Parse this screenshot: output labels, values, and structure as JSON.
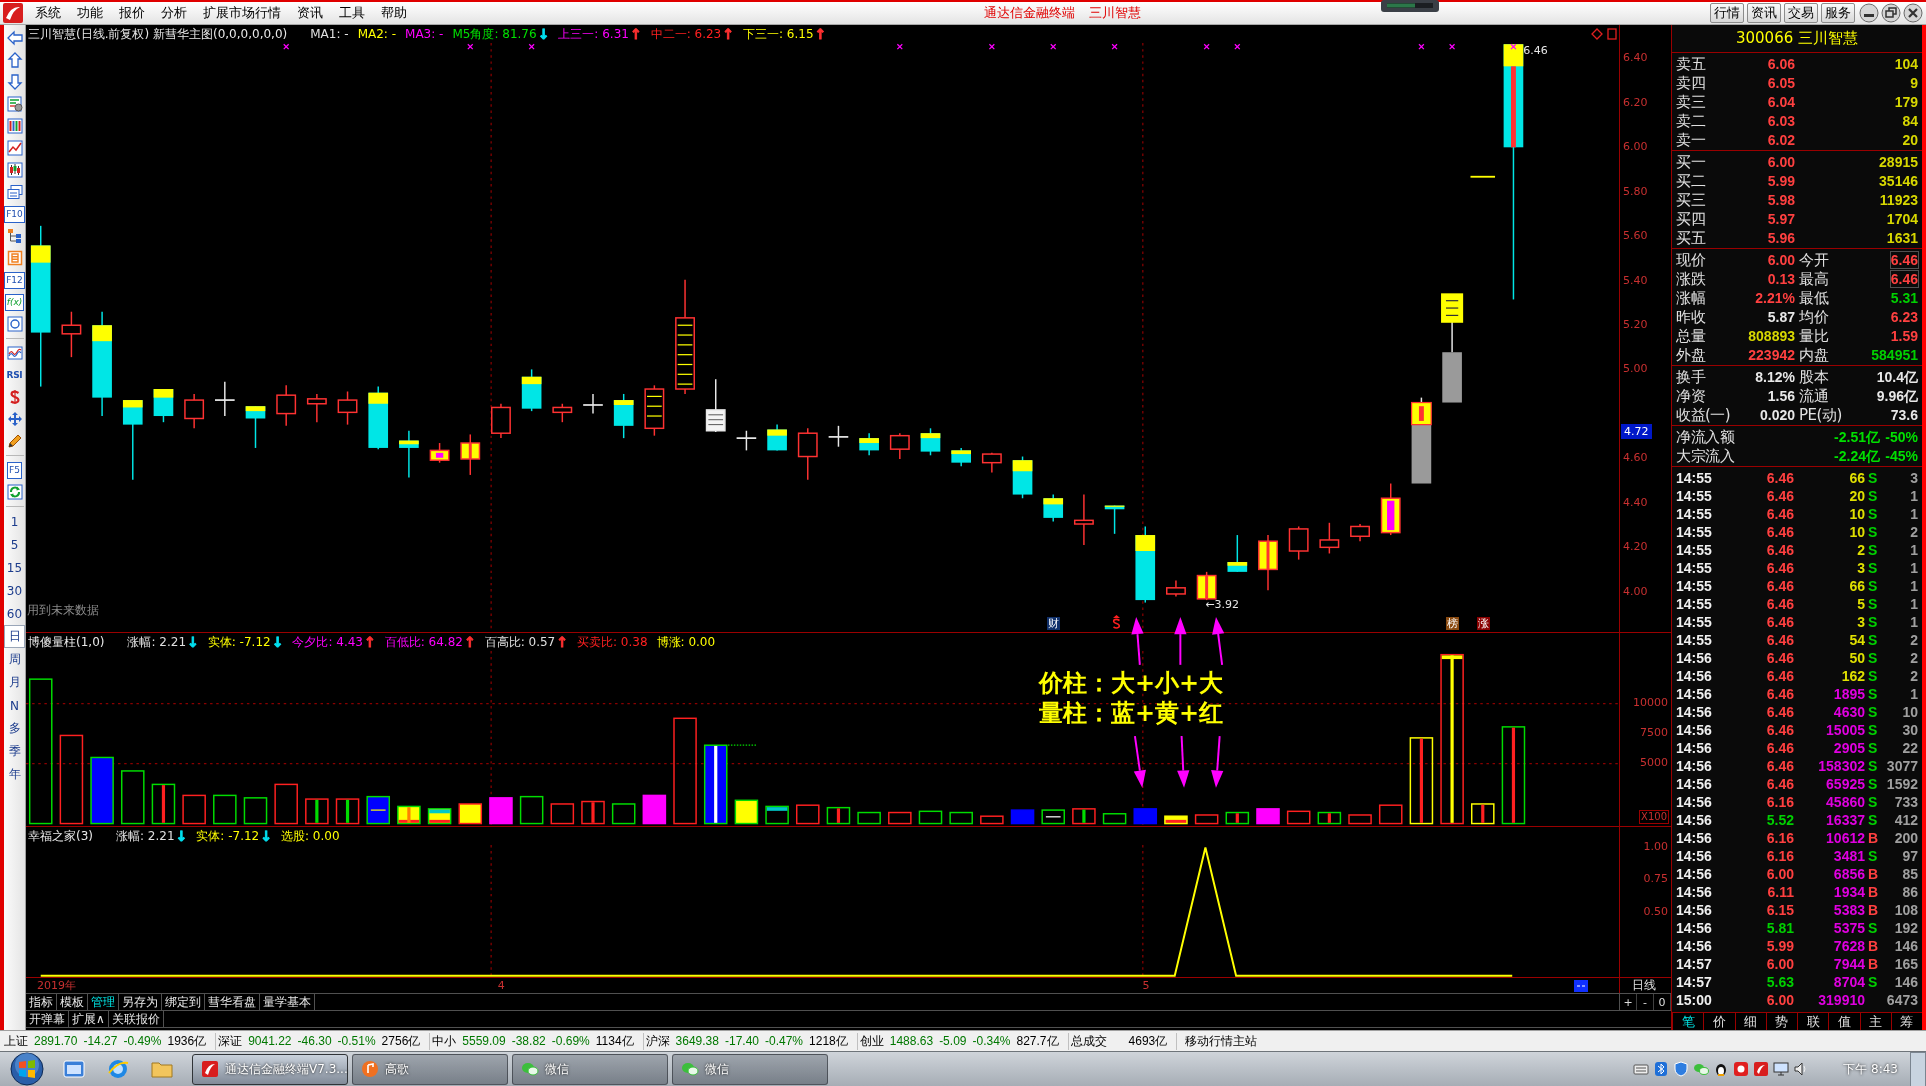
{
  "window": {
    "menu": [
      "系统",
      "功能",
      "报价",
      "分析",
      "扩展市场行情",
      "资讯",
      "工具",
      "帮助"
    ],
    "title": "通达信金融终端",
    "subtitle": "三川智慧",
    "buttons": [
      "行情",
      "资讯",
      "交易",
      "服务"
    ]
  },
  "toolbar": {
    "buttons": [
      {
        "label": "F10",
        "kind": "key"
      },
      {
        "label": "F12",
        "kind": "key"
      },
      {
        "label": "f(x)",
        "kind": "formula"
      },
      {
        "label": "RSI",
        "kind": "indicator"
      },
      {
        "label": "F5",
        "kind": "key"
      }
    ],
    "periods": [
      {
        "label": "1",
        "selected": false
      },
      {
        "label": "5",
        "selected": false
      },
      {
        "label": "15",
        "selected": false
      },
      {
        "label": "30",
        "selected": false
      },
      {
        "label": "60",
        "selected": false
      },
      {
        "label": "日",
        "selected": true
      },
      {
        "label": "周",
        "selected": false
      },
      {
        "label": "月",
        "selected": false
      },
      {
        "label": "N",
        "selected": false
      },
      {
        "label": "多",
        "selected": false
      },
      {
        "label": "季",
        "selected": false
      },
      {
        "label": "年",
        "selected": false
      }
    ]
  },
  "price_chart": {
    "title": "三川智慧(日线.前复权) 新彗华主图(0,0,0,0,0,0)",
    "readings": [
      {
        "text": "MA1: -",
        "color": "#e0e0e0"
      },
      {
        "text": "MA2: -",
        "color": "#ffff00"
      },
      {
        "text": "MA3: -",
        "color": "#ff00ff"
      },
      {
        "text": "M5角度: 81.76",
        "color": "#00e000",
        "arrow": {
          "text": "↓",
          "color": "#00e0f0"
        }
      },
      {
        "text": "上三一: 6.31",
        "color": "#ff00ff",
        "arrow": {
          "text": "↑",
          "color": "#ff3030"
        }
      },
      {
        "text": "中二一: 6.23",
        "color": "#ff2020",
        "arrow": {
          "text": "↑",
          "color": "#ff3030"
        }
      },
      {
        "text": "下三一: 6.15",
        "color": "#ffff00",
        "arrow": {
          "text": "↑",
          "color": "#ff3030"
        }
      }
    ],
    "axis": [
      "6.40",
      "6.20",
      "6.00",
      "5.80",
      "5.60",
      "5.40",
      "5.20",
      "5.00",
      "4.60",
      "4.40",
      "4.20",
      "4.00"
    ],
    "cursor_price": "4.72",
    "high_label": "6.46",
    "low_label": "←3.92",
    "note": "用到未来数据",
    "markers": [
      {
        "label": "财",
        "color": "#10306a"
      },
      {
        "label": "榜",
        "color": "#8a4a10"
      },
      {
        "label": "涨",
        "color": "#8a0000"
      }
    ],
    "annotations": [
      "价柱：大+小+大",
      "量柱：蓝+黄+红"
    ]
  },
  "volume_chart": {
    "title": "博傻量柱(1,0)",
    "readings": [
      {
        "text": "涨幅: 2.21",
        "color": "#e0e0e0",
        "arrow": {
          "text": "↓",
          "color": "#00e0f0"
        }
      },
      {
        "text": "实体: -7.12",
        "color": "#ffff00",
        "arrow": {
          "text": "↓",
          "color": "#00e0f0"
        }
      },
      {
        "text": "今夕比: 4.43",
        "color": "#ff00ff",
        "arrow": {
          "text": "↑",
          "color": "#ff3030"
        }
      },
      {
        "text": "百低比: 64.82",
        "color": "#ff00ff",
        "arrow": {
          "text": "↑",
          "color": "#ff3030"
        }
      },
      {
        "text": "百高比: 0.57",
        "color": "#e0e0e0",
        "arrow": {
          "text": "↑",
          "color": "#ff3030"
        }
      },
      {
        "text": "买卖比: 0.38",
        "color": "#ff2020"
      },
      {
        "text": "博涨: 0.00",
        "color": "#ffff00"
      }
    ],
    "axis": [
      "10000",
      "7500",
      "5000"
    ],
    "unit": "X100"
  },
  "indicator_chart": {
    "title": "幸福之家(3)",
    "readings": [
      {
        "text": "涨幅: 2.21",
        "color": "#e0e0e0",
        "arrow": {
          "text": "↓",
          "color": "#00e0f0"
        }
      },
      {
        "text": "实体: -7.12",
        "color": "#ffff00",
        "arrow": {
          "text": "↓",
          "color": "#00e0f0"
        }
      },
      {
        "text": "选股: 0.00",
        "color": "#ffff00"
      }
    ],
    "axis": [
      "1.00",
      "0.75",
      "0.50"
    ]
  },
  "date_axis": [
    "2019年",
    "4",
    "5"
  ],
  "period_label": "日线",
  "zoom_buttons": [
    "+",
    "-",
    "0"
  ],
  "bottom_tabs": [
    {
      "label": "指标",
      "selected": false
    },
    {
      "label": "模板",
      "selected": false
    },
    {
      "label": "管理",
      "selected": true
    },
    {
      "label": "另存为",
      "selected": false
    },
    {
      "label": "绑定到",
      "selected": false
    },
    {
      "label": "彗华看盘",
      "selected": false
    },
    {
      "label": "量学基本",
      "selected": false
    }
  ],
  "bottom_links": [
    "开弹幕",
    "扩展∧",
    "关联报价"
  ],
  "quote": {
    "title": "300066 三川智慧",
    "asks": [
      {
        "label": "卖五",
        "price": "6.06",
        "volume": "104"
      },
      {
        "label": "卖四",
        "price": "6.05",
        "volume": "9"
      },
      {
        "label": "卖三",
        "price": "6.04",
        "volume": "179"
      },
      {
        "label": "卖二",
        "price": "6.03",
        "volume": "84"
      },
      {
        "label": "卖一",
        "price": "6.02",
        "volume": "20"
      }
    ],
    "bids": [
      {
        "label": "买一",
        "price": "6.00",
        "volume": "28915"
      },
      {
        "label": "买二",
        "price": "5.99",
        "volume": "35146"
      },
      {
        "label": "买三",
        "price": "5.98",
        "volume": "11923"
      },
      {
        "label": "买四",
        "price": "5.97",
        "volume": "1704"
      },
      {
        "label": "买五",
        "price": "5.96",
        "volume": "1631"
      }
    ],
    "stats": [
      [
        {
          "label": "现价",
          "value": "6.00",
          "color": "#ff4040",
          "framed": false
        },
        {
          "label": "今开",
          "value": "6.46",
          "color": "#ff4040",
          "framed": true
        }
      ],
      [
        {
          "label": "涨跌",
          "value": "0.13",
          "color": "#ff4040",
          "framed": false
        },
        {
          "label": "最高",
          "value": "6.46",
          "color": "#ff4040",
          "framed": true
        }
      ],
      [
        {
          "label": "涨幅",
          "value": "2.21%",
          "color": "#ff4040",
          "framed": false
        },
        {
          "label": "最低",
          "value": "5.31",
          "color": "#00d000",
          "framed": false
        }
      ],
      [
        {
          "label": "昨收",
          "value": "5.87",
          "color": "#e8e8e8",
          "framed": false
        },
        {
          "label": "均价",
          "value": "6.23",
          "color": "#ff4040",
          "framed": false
        }
      ],
      [
        {
          "label": "总量",
          "value": "808893",
          "color": "#d8d800",
          "framed": false
        },
        {
          "label": "量比",
          "value": "1.59",
          "color": "#ff4040",
          "framed": false
        }
      ],
      [
        {
          "label": "外盘",
          "value": "223942",
          "color": "#ff4040",
          "framed": false
        },
        {
          "label": "内盘",
          "value": "584951",
          "color": "#00d000",
          "framed": false
        }
      ]
    ],
    "fundamentals": [
      [
        {
          "label": "换手",
          "value": "8.12%"
        },
        {
          "label": "股本",
          "value": "10.4亿"
        }
      ],
      [
        {
          "label": "净资",
          "value": "1.56"
        },
        {
          "label": "流通",
          "value": "9.96亿"
        }
      ],
      [
        {
          "label": "收益(一)",
          "value": "0.020"
        },
        {
          "label": "PE(动)",
          "value": "73.6"
        }
      ]
    ],
    "flows": [
      {
        "label": "净流入额",
        "amount": "-2.51亿",
        "pct": "-50%"
      },
      {
        "label": "大宗流入",
        "amount": "-2.24亿",
        "pct": "-45%"
      }
    ],
    "ticks": [
      {
        "time": "14:55",
        "price": {
          "text": "6.46",
          "color": "#ff4040"
        },
        "volume": {
          "text": "66",
          "color": "#e0e000"
        },
        "side": {
          "text": "S",
          "color": "#00d000"
        },
        "count": "3"
      },
      {
        "time": "14:55",
        "price": {
          "text": "6.46",
          "color": "#ff4040"
        },
        "volume": {
          "text": "20",
          "color": "#e0e000"
        },
        "side": {
          "text": "S",
          "color": "#00d000"
        },
        "count": "1"
      },
      {
        "time": "14:55",
        "price": {
          "text": "6.46",
          "color": "#ff4040"
        },
        "volume": {
          "text": "10",
          "color": "#e0e000"
        },
        "side": {
          "text": "S",
          "color": "#00d000"
        },
        "count": "1"
      },
      {
        "time": "14:55",
        "price": {
          "text": "6.46",
          "color": "#ff4040"
        },
        "volume": {
          "text": "10",
          "color": "#e0e000"
        },
        "side": {
          "text": "S",
          "color": "#00d000"
        },
        "count": "2"
      },
      {
        "time": "14:55",
        "price": {
          "text": "6.46",
          "color": "#ff4040"
        },
        "volume": {
          "text": "2",
          "color": "#e0e000"
        },
        "side": {
          "text": "S",
          "color": "#00d000"
        },
        "count": "1"
      },
      {
        "time": "14:55",
        "price": {
          "text": "6.46",
          "color": "#ff4040"
        },
        "volume": {
          "text": "3",
          "color": "#e0e000"
        },
        "side": {
          "text": "S",
          "color": "#00d000"
        },
        "count": "1"
      },
      {
        "time": "14:55",
        "price": {
          "text": "6.46",
          "color": "#ff4040"
        },
        "volume": {
          "text": "66",
          "color": "#e0e000"
        },
        "side": {
          "text": "S",
          "color": "#00d000"
        },
        "count": "1"
      },
      {
        "time": "14:55",
        "price": {
          "text": "6.46",
          "color": "#ff4040"
        },
        "volume": {
          "text": "5",
          "color": "#e0e000"
        },
        "side": {
          "text": "S",
          "color": "#00d000"
        },
        "count": "1"
      },
      {
        "time": "14:55",
        "price": {
          "text": "6.46",
          "color": "#ff4040"
        },
        "volume": {
          "text": "3",
          "color": "#e0e000"
        },
        "side": {
          "text": "S",
          "color": "#00d000"
        },
        "count": "1"
      },
      {
        "time": "14:55",
        "price": {
          "text": "6.46",
          "color": "#ff4040"
        },
        "volume": {
          "text": "54",
          "color": "#e0e000"
        },
        "side": {
          "text": "S",
          "color": "#00d000"
        },
        "count": "2"
      },
      {
        "time": "14:56",
        "price": {
          "text": "6.46",
          "color": "#ff4040"
        },
        "volume": {
          "text": "50",
          "color": "#e0e000"
        },
        "side": {
          "text": "S",
          "color": "#00d000"
        },
        "count": "2"
      },
      {
        "time": "14:56",
        "price": {
          "text": "6.46",
          "color": "#ff4040"
        },
        "volume": {
          "text": "162",
          "color": "#e0e000"
        },
        "side": {
          "text": "S",
          "color": "#00d000"
        },
        "count": "2"
      },
      {
        "time": "14:56",
        "price": {
          "text": "6.46",
          "color": "#ff4040"
        },
        "volume": {
          "text": "1895",
          "color": "#e000e0"
        },
        "side": {
          "text": "S",
          "color": "#00d000"
        },
        "count": "1"
      },
      {
        "time": "14:56",
        "price": {
          "text": "6.46",
          "color": "#ff4040"
        },
        "volume": {
          "text": "4630",
          "color": "#e000e0"
        },
        "side": {
          "text": "S",
          "color": "#00d000"
        },
        "count": "10"
      },
      {
        "time": "14:56",
        "price": {
          "text": "6.46",
          "color": "#ff4040"
        },
        "volume": {
          "text": "15005",
          "color": "#e000e0"
        },
        "side": {
          "text": "S",
          "color": "#00d000"
        },
        "count": "30"
      },
      {
        "time": "14:56",
        "price": {
          "text": "6.46",
          "color": "#ff4040"
        },
        "volume": {
          "text": "2905",
          "color": "#e000e0"
        },
        "side": {
          "text": "S",
          "color": "#00d000"
        },
        "count": "22"
      },
      {
        "time": "14:56",
        "price": {
          "text": "6.46",
          "color": "#ff4040"
        },
        "volume": {
          "text": "158302",
          "color": "#e000e0"
        },
        "side": {
          "text": "S",
          "color": "#00d000"
        },
        "count": "3077"
      },
      {
        "time": "14:56",
        "price": {
          "text": "6.46",
          "color": "#ff4040"
        },
        "volume": {
          "text": "65925",
          "color": "#e000e0"
        },
        "side": {
          "text": "S",
          "color": "#00d000"
        },
        "count": "1592"
      },
      {
        "time": "14:56",
        "price": {
          "text": "6.16",
          "color": "#ff4040"
        },
        "volume": {
          "text": "45860",
          "color": "#e000e0"
        },
        "side": {
          "text": "S",
          "color": "#00d000"
        },
        "count": "733"
      },
      {
        "time": "14:56",
        "price": {
          "text": "5.52",
          "color": "#00d000"
        },
        "volume": {
          "text": "16337",
          "color": "#e000e0"
        },
        "side": {
          "text": "S",
          "color": "#00d000"
        },
        "count": "412"
      },
      {
        "time": "14:56",
        "price": {
          "text": "6.16",
          "color": "#ff4040"
        },
        "volume": {
          "text": "10612",
          "color": "#e000e0"
        },
        "side": {
          "text": "B",
          "color": "#ff4040"
        },
        "count": "200"
      },
      {
        "time": "14:56",
        "price": {
          "text": "6.16",
          "color": "#ff4040"
        },
        "volume": {
          "text": "3481",
          "color": "#e000e0"
        },
        "side": {
          "text": "S",
          "color": "#00d000"
        },
        "count": "97"
      },
      {
        "time": "14:56",
        "price": {
          "text": "6.00",
          "color": "#ff4040"
        },
        "volume": {
          "text": "6856",
          "color": "#e000e0"
        },
        "side": {
          "text": "B",
          "color": "#ff4040"
        },
        "count": "85"
      },
      {
        "time": "14:56",
        "price": {
          "text": "6.11",
          "color": "#ff4040"
        },
        "volume": {
          "text": "1934",
          "color": "#e000e0"
        },
        "side": {
          "text": "B",
          "color": "#ff4040"
        },
        "count": "86"
      },
      {
        "time": "14:56",
        "price": {
          "text": "6.15",
          "color": "#ff4040"
        },
        "volume": {
          "text": "5383",
          "color": "#e000e0"
        },
        "side": {
          "text": "B",
          "color": "#ff4040"
        },
        "count": "108"
      },
      {
        "time": "14:56",
        "price": {
          "text": "5.81",
          "color": "#00d000"
        },
        "volume": {
          "text": "5375",
          "color": "#e000e0"
        },
        "side": {
          "text": "S",
          "color": "#00d000"
        },
        "count": "192"
      },
      {
        "time": "14:56",
        "price": {
          "text": "5.99",
          "color": "#ff4040"
        },
        "volume": {
          "text": "7628",
          "color": "#e000e0"
        },
        "side": {
          "text": "B",
          "color": "#ff4040"
        },
        "count": "146"
      },
      {
        "time": "14:57",
        "price": {
          "text": "6.00",
          "color": "#ff4040"
        },
        "volume": {
          "text": "7944",
          "color": "#e000e0"
        },
        "side": {
          "text": "B",
          "color": "#ff4040"
        },
        "count": "165"
      },
      {
        "time": "14:57",
        "price": {
          "text": "5.63",
          "color": "#00d000"
        },
        "volume": {
          "text": "8704",
          "color": "#e000e0"
        },
        "side": {
          "text": "S",
          "color": "#00d000"
        },
        "count": "146"
      },
      {
        "time": "15:00",
        "price": {
          "text": "6.00",
          "color": "#ff4040"
        },
        "volume": {
          "text": "319910",
          "color": "#e000e0"
        },
        "count": "6473"
      }
    ]
  },
  "quote_tabs": [
    {
      "label": "笔",
      "selected": true
    },
    {
      "label": "价",
      "selected": false
    },
    {
      "label": "细",
      "selected": false
    },
    {
      "label": "势",
      "selected": false
    },
    {
      "label": "联",
      "selected": false
    },
    {
      "label": "值",
      "selected": false
    },
    {
      "label": "主",
      "selected": false
    },
    {
      "label": "筹",
      "selected": false
    }
  ],
  "status_bar": {
    "indices": [
      {
        "name": "上证",
        "value": "2891.70",
        "change": "-14.27",
        "pct": "-0.49%",
        "amount": "1936亿"
      },
      {
        "name": "深证",
        "value": "9041.22",
        "change": "-46.30",
        "pct": "-0.51%",
        "amount": "2756亿"
      },
      {
        "name": "中小",
        "value": "5559.09",
        "change": "-38.82",
        "pct": "-0.69%",
        "amount": "1134亿"
      },
      {
        "name": "沪深",
        "value": "3649.38",
        "change": "-17.40",
        "pct": "-0.47%",
        "amount": "1218亿"
      },
      {
        "name": "创业",
        "value": "1488.63",
        "change": "-5.09",
        "pct": "-0.34%",
        "amount": "827.7亿"
      }
    ],
    "total_label": "总成交",
    "total": "4693亿",
    "server": "移动行情主站"
  },
  "taskbar": {
    "tasks": [
      {
        "label": "通达信金融终端V7.3...",
        "selected": true
      },
      {
        "label": "高歌",
        "selected": false
      },
      {
        "label": "微信",
        "selected": false
      },
      {
        "label": "微信",
        "selected": false
      }
    ],
    "clock": "下午 8:43"
  }
}
